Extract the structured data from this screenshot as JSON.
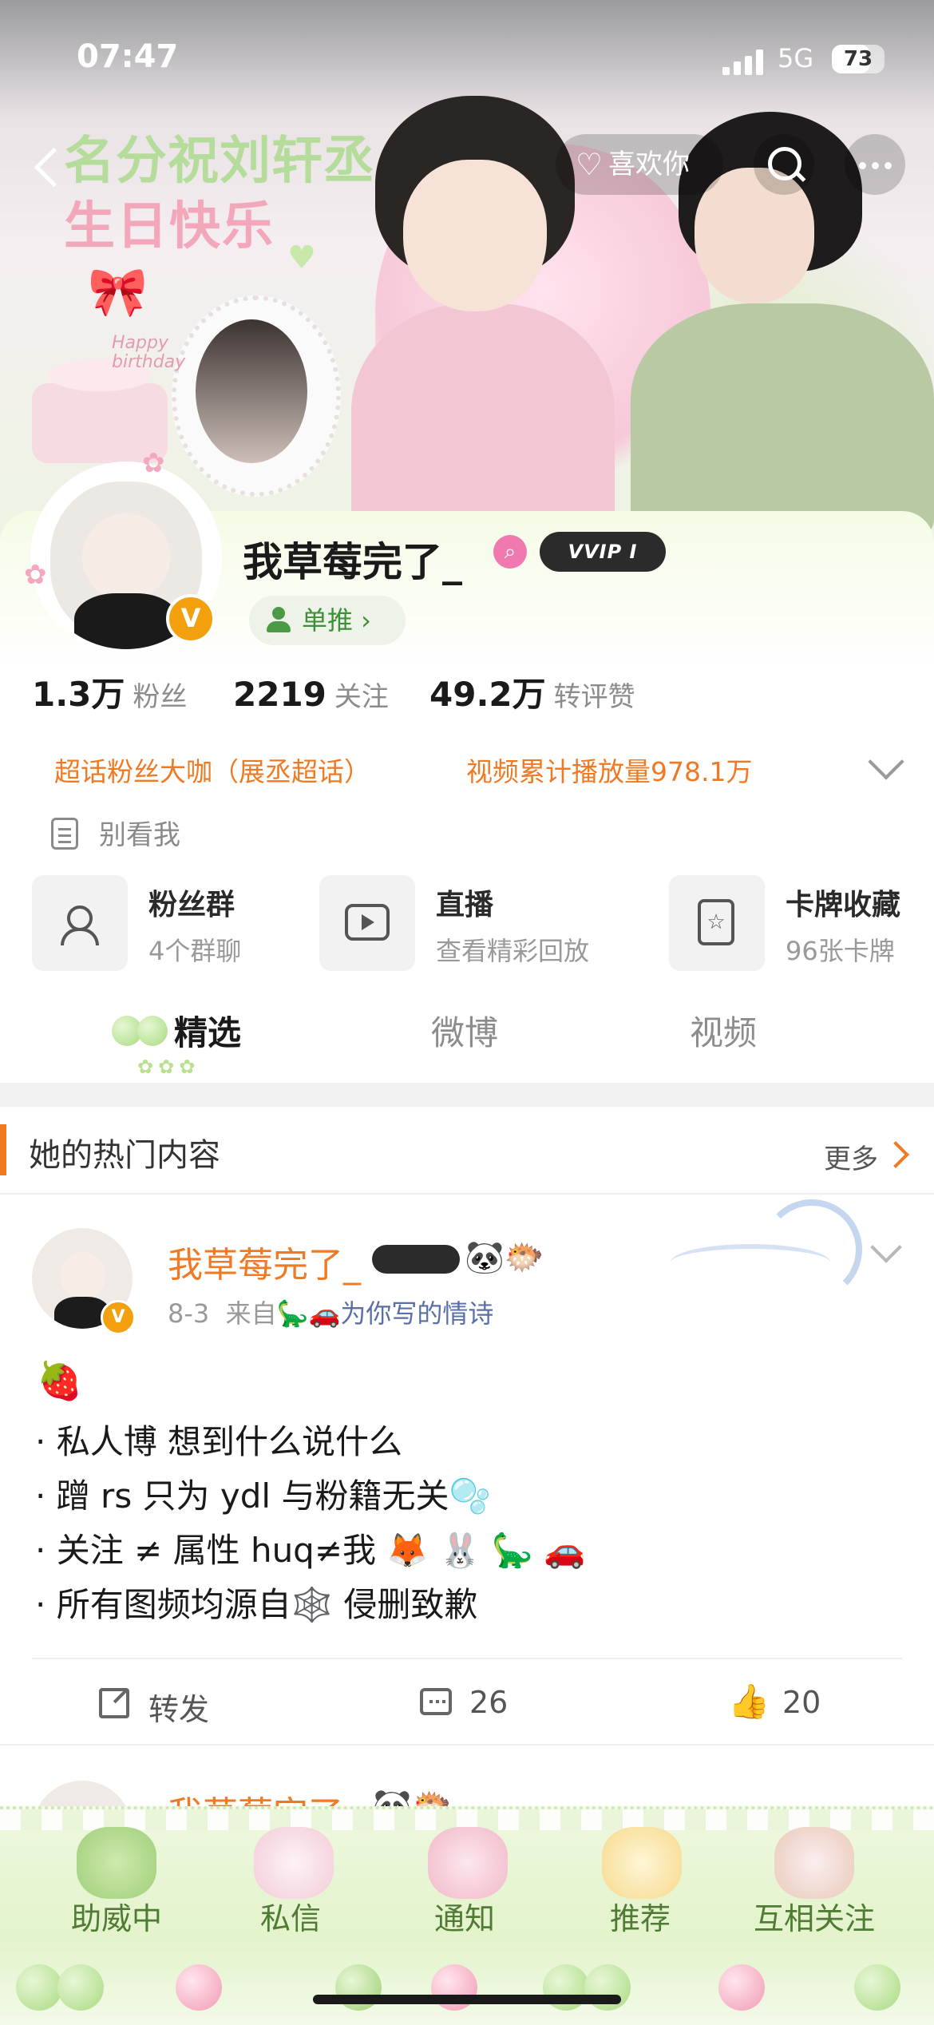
{
  "status_bar": {
    "time": "07:47",
    "network": "5G",
    "battery": "73"
  },
  "banner": {
    "title_line1": "名分祝刘轩丞",
    "title_line2": "生日快乐",
    "subtitle": "Happy birthday"
  },
  "nav": {
    "like_label": "喜欢你"
  },
  "profile": {
    "username": "我草莓完了_",
    "vip_label": "VVIP I",
    "single_pill_label": "单推 ›",
    "stats": [
      {
        "value": "1.3万",
        "label": "粉丝"
      },
      {
        "value": "2219",
        "label": "关注"
      },
      {
        "value": "49.2万",
        "label": "转评赞"
      }
    ],
    "tags": [
      "超话粉丝大咖（展丞超话）",
      "视频累计播放量978.1万"
    ],
    "bio": "别看我"
  },
  "features": [
    {
      "title": "粉丝群",
      "subtitle": "4个群聊"
    },
    {
      "title": "直播",
      "subtitle": "查看精彩回放"
    },
    {
      "title": "卡牌收藏",
      "subtitle": "96张卡牌"
    }
  ],
  "tabs": [
    "精选",
    "微博",
    "视频"
  ],
  "hot": {
    "title": "她的热门内容",
    "more": "更多"
  },
  "post": {
    "author": "我草莓完了_",
    "emojis": "🐼🐡",
    "date": "8-3",
    "from_label": "来自",
    "source": "🦕🚗为你写的情诗",
    "lines": [
      "🍓",
      "· 私人博 想到什么说什么",
      "· 蹭 rs 只为 ydl 与粉籍无关🫧",
      "· 关注 ≠ 属性  huq≠我 🦊 🐰  🦕 🚗",
      "· 所有图频均源自🕸️ 侵删致歉"
    ],
    "repost_label": "转发",
    "comments": "26",
    "likes": "20"
  },
  "peek": {
    "author": "我草莓完了_",
    "emojis": "🐼🐡"
  },
  "bottom_nav": [
    "助威中",
    "私信",
    "通知",
    "推荐",
    "互相关注"
  ],
  "colors": {
    "accent": "#f07a23",
    "green": "#4f7b34",
    "verified": "#f3a00f"
  },
  "icons": [
    "back-icon",
    "like-icon",
    "search-icon",
    "more-icon",
    "verified-icon",
    "doc-icon",
    "group-icon",
    "tv-icon",
    "card-icon",
    "share-icon",
    "comment-icon",
    "thumbs-up-icon"
  ]
}
